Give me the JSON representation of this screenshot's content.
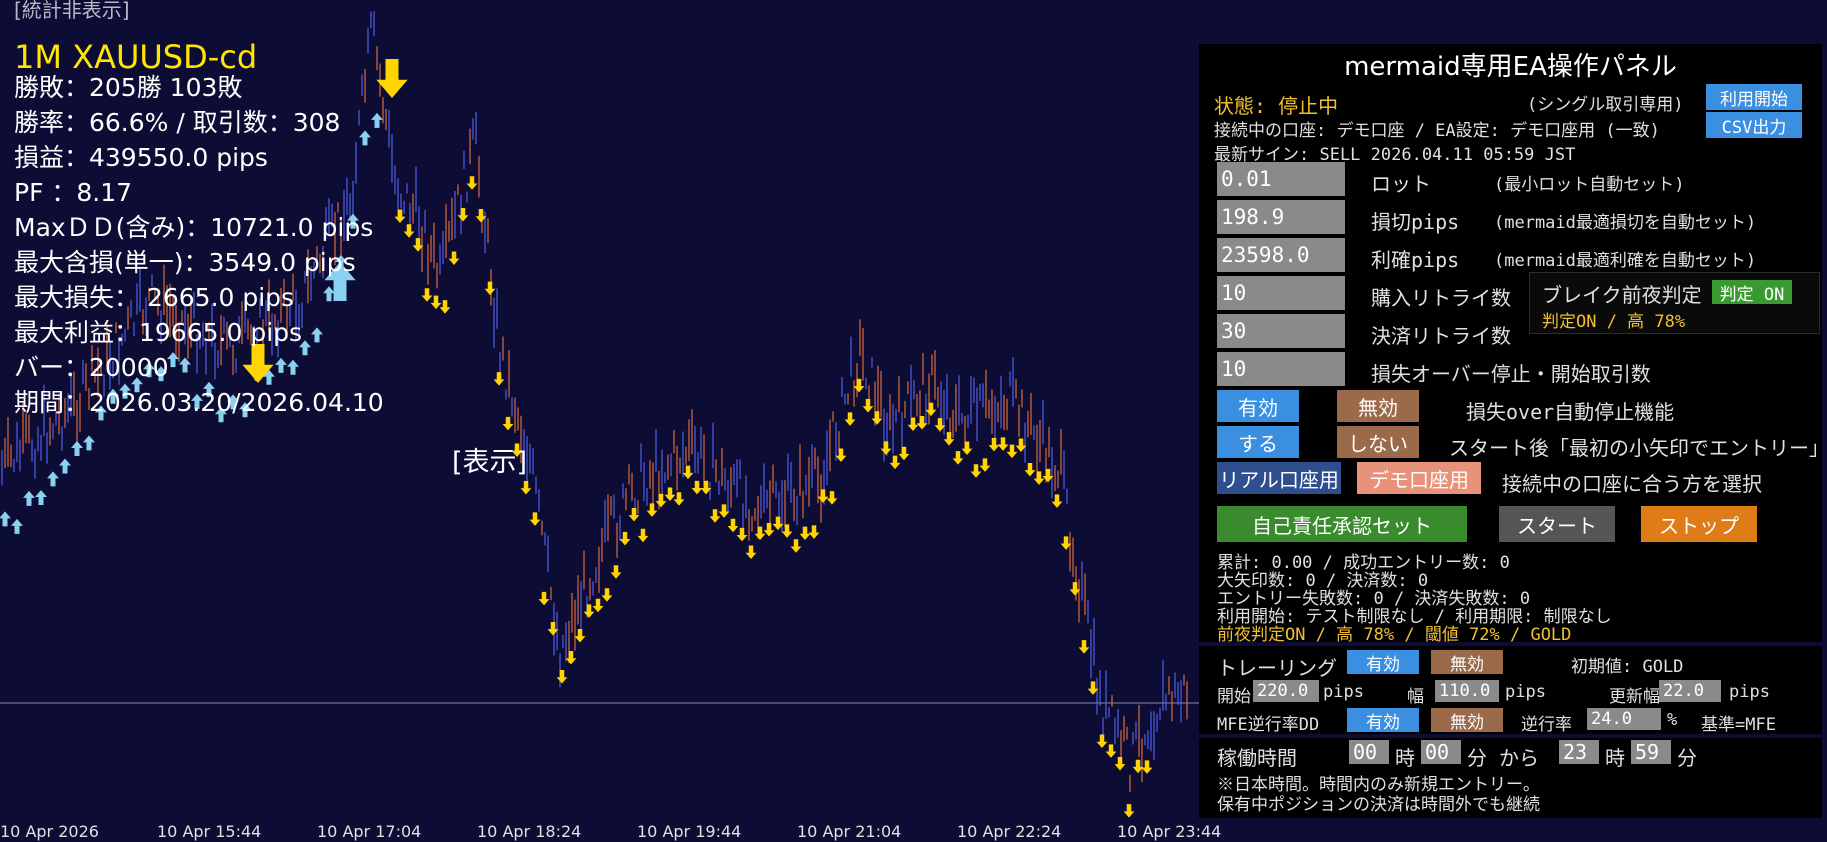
{
  "chart": {
    "hidden_stats_label": "[統計非表示]",
    "symbol": "1M XAUUSD-cd",
    "stats": [
      "勝敗：205勝 103敗",
      "勝率：66.6%  /  取引数：308",
      "損益：439550.0 pips",
      "PF  ：8.17",
      "MaxＤＤ(含み)：10721.0 pips",
      "最大含損(単一)：3549.0 pips",
      "最大損失：   2665.0 pips",
      "最大利益：19665.0 pips",
      "バー：20000",
      "期間：2026.03.20/2026.04.10"
    ],
    "show_label": "[表示]",
    "x_axis": [
      "10 Apr 2026",
      "10 Apr 15:44",
      "10 Apr 17:04",
      "10 Apr 18:24",
      "10 Apr 19:44",
      "10 Apr 21:04",
      "10 Apr 22:24",
      "10 Apr 23:44"
    ],
    "colors": {
      "background": "#0c0c34",
      "candle_up": "#4a5ad8",
      "candle_down": "#c8643a",
      "sell_arrow": "#ffd400",
      "buy_arrow": "#8ad0f0"
    }
  },
  "panel": {
    "title": "mermaid専用EA操作パネル",
    "status": "状態: 停止中",
    "mode": "(シングル取引専用)",
    "start_use_button": "利用開始",
    "account_info": "接続中の口座: デモ口座 / EA設定: デモ口座用 (一致)",
    "csv_button": "CSV出力",
    "latest_sign": "最新サイン: SELL 2026.04.11 05:59 JST",
    "fields": [
      {
        "value": "0.01",
        "label": "ロット",
        "note": "(最小ロット自動セット)"
      },
      {
        "value": "198.9",
        "label": "損切pips",
        "note": "(mermaid最適損切を自動セット)"
      },
      {
        "value": "23598.0",
        "label": "利確pips",
        "note": "(mermaid最適利確を自動セット)"
      },
      {
        "value": "10",
        "label": "購入リトライ数",
        "note": ""
      },
      {
        "value": "30",
        "label": "決済リトライ数",
        "note": ""
      },
      {
        "value": "10",
        "label": "損失オーバー停止・開始取引数",
        "note": ""
      }
    ],
    "break_box": {
      "title": "ブレイク前夜判定",
      "toggle": "判定 ON",
      "detail": "判定ON / 高 78%"
    },
    "loss_stop": {
      "on": "有効",
      "off": "無効",
      "label": "損失over自動停止機能"
    },
    "first_arrow": {
      "on": "する",
      "off": "しない",
      "label": "スタート後「最初の小矢印でエントリー」"
    },
    "account_select": {
      "real": "リアル口座用",
      "demo": "デモ口座用",
      "label": "接続中の口座に合う方を選択"
    },
    "actions": {
      "approve": "自己責任承認セット",
      "start": "スタート",
      "stop": "ストップ"
    },
    "summary": [
      "累計: 0.00 / 成功エントリー数: 0",
      "大矢印数: 0 / 決済数: 0",
      "エントリー失敗数: 0 / 決済失敗数: 0",
      "利用開始: テスト制限なし / 利用期限: 制限なし"
    ],
    "summary_highlight": "前夜判定ON / 高 78% / 閾値 72% / GOLD",
    "trailing": {
      "label": "トレーリング",
      "on": "有効",
      "off": "無効",
      "initial": "初期値: GOLD",
      "start_label": "開始",
      "start_value": "220.0",
      "pips1": "pips",
      "width_label": "幅",
      "width_value": "110.0",
      "pips2": "pips",
      "update_label": "更新幅",
      "update_value": "22.0",
      "pips3": "pips",
      "mfe_label": "MFE逆行率DD",
      "mfe_on": "有効",
      "mfe_off": "無効",
      "reverse_label": "逆行率",
      "reverse_value": "24.0",
      "percent": "%",
      "basis": "基準=MFE"
    },
    "schedule": {
      "label": "稼働時間",
      "start_h": "00",
      "h1": "時",
      "start_m": "00",
      "m1": "分 から",
      "end_h": "23",
      "h2": "時",
      "end_m": "59",
      "m2": "分",
      "note1": "※日本時間。時間内のみ新規エントリー。",
      "note2": "保有中ポジションの決済は時間外でも継続"
    }
  }
}
